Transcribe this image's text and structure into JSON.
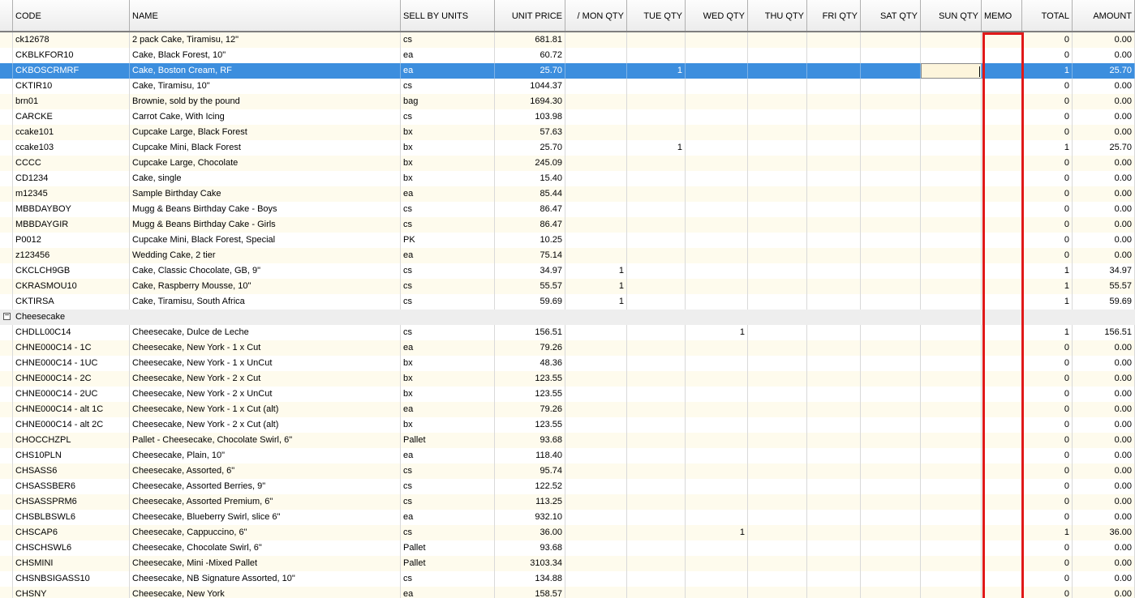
{
  "grid": {
    "columns": [
      {
        "key": "code",
        "label": "CODE",
        "align": "left"
      },
      {
        "key": "name",
        "label": "NAME",
        "align": "left"
      },
      {
        "key": "units",
        "label": "SELL BY UNITS",
        "align": "left"
      },
      {
        "key": "price",
        "label": "UNIT PRICE",
        "align": "right"
      },
      {
        "key": "mon",
        "label": "/  MON QTY",
        "align": "right"
      },
      {
        "key": "tue",
        "label": "TUE QTY",
        "align": "right"
      },
      {
        "key": "wed",
        "label": "WED QTY",
        "align": "right"
      },
      {
        "key": "thu",
        "label": "THU QTY",
        "align": "right"
      },
      {
        "key": "fri",
        "label": "FRI QTY",
        "align": "right"
      },
      {
        "key": "sat",
        "label": "SAT QTY",
        "align": "right"
      },
      {
        "key": "sun",
        "label": "SUN QTY",
        "align": "right"
      },
      {
        "key": "memo",
        "label": "MEMO",
        "align": "left"
      },
      {
        "key": "total",
        "label": "TOTAL",
        "align": "right"
      },
      {
        "key": "amount",
        "label": "AMOUNT",
        "align": "right"
      }
    ],
    "rows": [
      {
        "code": "ck12678",
        "name": "2 pack Cake, Tiramisu, 12\"",
        "units": "cs",
        "price": "681.81",
        "mon": "",
        "tue": "",
        "wed": "",
        "thu": "",
        "fri": "",
        "sat": "",
        "sun": "",
        "memo": "",
        "total": "0",
        "amount": "0.00"
      },
      {
        "code": "CKBLKFOR10",
        "name": "Cake, Black Forest, 10\"",
        "units": "ea",
        "price": "60.72",
        "mon": "",
        "tue": "",
        "wed": "",
        "thu": "",
        "fri": "",
        "sat": "",
        "sun": "",
        "memo": "",
        "total": "0",
        "amount": "0.00"
      },
      {
        "code": "CKBOSCRMRF",
        "name": "Cake, Boston Cream, RF",
        "units": "ea",
        "price": "25.70",
        "mon": "",
        "tue": "1",
        "wed": "",
        "thu": "",
        "fri": "",
        "sat": "",
        "sun": "",
        "memo": "",
        "total": "1",
        "amount": "25.70",
        "selected": true
      },
      {
        "code": "CKTIR10",
        "name": "Cake, Tiramisu, 10\"",
        "units": "cs",
        "price": "1044.37",
        "mon": "",
        "tue": "",
        "wed": "",
        "thu": "",
        "fri": "",
        "sat": "",
        "sun": "",
        "memo": "",
        "total": "0",
        "amount": "0.00"
      },
      {
        "code": "brn01",
        "name": "Brownie, sold by the pound",
        "units": "bag",
        "price": "1694.30",
        "mon": "",
        "tue": "",
        "wed": "",
        "thu": "",
        "fri": "",
        "sat": "",
        "sun": "",
        "memo": "",
        "total": "0",
        "amount": "0.00"
      },
      {
        "code": "CARCKE",
        "name": "Carrot Cake, With Icing",
        "units": "cs",
        "price": "103.98",
        "mon": "",
        "tue": "",
        "wed": "",
        "thu": "",
        "fri": "",
        "sat": "",
        "sun": "",
        "memo": "",
        "total": "0",
        "amount": "0.00"
      },
      {
        "code": "ccake101",
        "name": "Cupcake Large, Black Forest",
        "units": "bx",
        "price": "57.63",
        "mon": "",
        "tue": "",
        "wed": "",
        "thu": "",
        "fri": "",
        "sat": "",
        "sun": "",
        "memo": "",
        "total": "0",
        "amount": "0.00"
      },
      {
        "code": "ccake103",
        "name": "Cupcake Mini, Black Forest",
        "units": "bx",
        "price": "25.70",
        "mon": "",
        "tue": "1",
        "wed": "",
        "thu": "",
        "fri": "",
        "sat": "",
        "sun": "",
        "memo": "",
        "total": "1",
        "amount": "25.70"
      },
      {
        "code": "CCCC",
        "name": "Cupcake Large, Chocolate",
        "units": "bx",
        "price": "245.09",
        "mon": "",
        "tue": "",
        "wed": "",
        "thu": "",
        "fri": "",
        "sat": "",
        "sun": "",
        "memo": "",
        "total": "0",
        "amount": "0.00"
      },
      {
        "code": "CD1234",
        "name": "Cake, single",
        "units": "bx",
        "price": "15.40",
        "mon": "",
        "tue": "",
        "wed": "",
        "thu": "",
        "fri": "",
        "sat": "",
        "sun": "",
        "memo": "",
        "total": "0",
        "amount": "0.00"
      },
      {
        "code": "m12345",
        "name": "Sample Birthday Cake",
        "units": "ea",
        "price": "85.44",
        "mon": "",
        "tue": "",
        "wed": "",
        "thu": "",
        "fri": "",
        "sat": "",
        "sun": "",
        "memo": "",
        "total": "0",
        "amount": "0.00"
      },
      {
        "code": "MBBDAYBOY",
        "name": "Mugg & Beans Birthday Cake - Boys",
        "units": "cs",
        "price": "86.47",
        "mon": "",
        "tue": "",
        "wed": "",
        "thu": "",
        "fri": "",
        "sat": "",
        "sun": "",
        "memo": "",
        "total": "0",
        "amount": "0.00"
      },
      {
        "code": "MBBDAYGIR",
        "name": "Mugg & Beans Birthday Cake - Girls",
        "units": "cs",
        "price": "86.47",
        "mon": "",
        "tue": "",
        "wed": "",
        "thu": "",
        "fri": "",
        "sat": "",
        "sun": "",
        "memo": "",
        "total": "0",
        "amount": "0.00"
      },
      {
        "code": "P0012",
        "name": "Cupcake Mini, Black Forest, Special",
        "units": "PK",
        "price": "10.25",
        "mon": "",
        "tue": "",
        "wed": "",
        "thu": "",
        "fri": "",
        "sat": "",
        "sun": "",
        "memo": "",
        "total": "0",
        "amount": "0.00"
      },
      {
        "code": "z123456",
        "name": "Wedding Cake, 2 tier",
        "units": "ea",
        "price": "75.14",
        "mon": "",
        "tue": "",
        "wed": "",
        "thu": "",
        "fri": "",
        "sat": "",
        "sun": "",
        "memo": "",
        "total": "0",
        "amount": "0.00"
      },
      {
        "code": "CKCLCH9GB",
        "name": "Cake, Classic Chocolate, GB, 9\"",
        "units": "cs",
        "price": "34.97",
        "mon": "1",
        "tue": "",
        "wed": "",
        "thu": "",
        "fri": "",
        "sat": "",
        "sun": "",
        "memo": "",
        "total": "1",
        "amount": "34.97"
      },
      {
        "code": "CKRASMOU10",
        "name": "Cake, Raspberry Mousse, 10\"",
        "units": "cs",
        "price": "55.57",
        "mon": "1",
        "tue": "",
        "wed": "",
        "thu": "",
        "fri": "",
        "sat": "",
        "sun": "",
        "memo": "",
        "total": "1",
        "amount": "55.57"
      },
      {
        "code": "CKTIRSA",
        "name": "Cake, Tiramisu, South Africa",
        "units": "cs",
        "price": "59.69",
        "mon": "1",
        "tue": "",
        "wed": "",
        "thu": "",
        "fri": "",
        "sat": "",
        "sun": "",
        "memo": "",
        "total": "1",
        "amount": "59.69"
      },
      {
        "group": "Cheesecake",
        "toggle": "−"
      },
      {
        "code": "CHDLL00C14",
        "name": "Cheesecake, Dulce de Leche",
        "units": "cs",
        "price": "156.51",
        "mon": "",
        "tue": "",
        "wed": "1",
        "thu": "",
        "fri": "",
        "sat": "",
        "sun": "",
        "memo": "",
        "total": "1",
        "amount": "156.51"
      },
      {
        "code": "CHNE000C14 - 1C",
        "name": "Cheesecake, New York - 1 x Cut",
        "units": "ea",
        "price": "79.26",
        "mon": "",
        "tue": "",
        "wed": "",
        "thu": "",
        "fri": "",
        "sat": "",
        "sun": "",
        "memo": "",
        "total": "0",
        "amount": "0.00"
      },
      {
        "code": "CHNE000C14 - 1UC",
        "name": "Cheesecake, New York - 1 x UnCut",
        "units": "bx",
        "price": "48.36",
        "mon": "",
        "tue": "",
        "wed": "",
        "thu": "",
        "fri": "",
        "sat": "",
        "sun": "",
        "memo": "",
        "total": "0",
        "amount": "0.00"
      },
      {
        "code": "CHNE000C14 - 2C",
        "name": "Cheesecake, New York - 2 x Cut",
        "units": "bx",
        "price": "123.55",
        "mon": "",
        "tue": "",
        "wed": "",
        "thu": "",
        "fri": "",
        "sat": "",
        "sun": "",
        "memo": "",
        "total": "0",
        "amount": "0.00"
      },
      {
        "code": "CHNE000C14 - 2UC",
        "name": "Cheesecake, New York - 2 x UnCut",
        "units": "bx",
        "price": "123.55",
        "mon": "",
        "tue": "",
        "wed": "",
        "thu": "",
        "fri": "",
        "sat": "",
        "sun": "",
        "memo": "",
        "total": "0",
        "amount": "0.00"
      },
      {
        "code": "CHNE000C14 - alt 1C",
        "name": "Cheesecake, New York - 1 x Cut (alt)",
        "units": "ea",
        "price": "79.26",
        "mon": "",
        "tue": "",
        "wed": "",
        "thu": "",
        "fri": "",
        "sat": "",
        "sun": "",
        "memo": "",
        "total": "0",
        "amount": "0.00"
      },
      {
        "code": "CHNE000C14 - alt 2C",
        "name": "Cheesecake, New York - 2 x Cut (alt)",
        "units": "bx",
        "price": "123.55",
        "mon": "",
        "tue": "",
        "wed": "",
        "thu": "",
        "fri": "",
        "sat": "",
        "sun": "",
        "memo": "",
        "total": "0",
        "amount": "0.00"
      },
      {
        "code": "CHOCCHZPL",
        "name": "Pallet - Cheesecake, Chocolate Swirl, 6\"",
        "units": "Pallet",
        "price": "93.68",
        "mon": "",
        "tue": "",
        "wed": "",
        "thu": "",
        "fri": "",
        "sat": "",
        "sun": "",
        "memo": "",
        "total": "0",
        "amount": "0.00"
      },
      {
        "code": "CHS10PLN",
        "name": "Cheesecake, Plain, 10\"",
        "units": "ea",
        "price": "118.40",
        "mon": "",
        "tue": "",
        "wed": "",
        "thu": "",
        "fri": "",
        "sat": "",
        "sun": "",
        "memo": "",
        "total": "0",
        "amount": "0.00"
      },
      {
        "code": "CHSASS6",
        "name": "Cheesecake, Assorted, 6\"",
        "units": "cs",
        "price": "95.74",
        "mon": "",
        "tue": "",
        "wed": "",
        "thu": "",
        "fri": "",
        "sat": "",
        "sun": "",
        "memo": "",
        "total": "0",
        "amount": "0.00"
      },
      {
        "code": "CHSASSBER6",
        "name": "Cheesecake, Assorted Berries, 9\"",
        "units": "cs",
        "price": "122.52",
        "mon": "",
        "tue": "",
        "wed": "",
        "thu": "",
        "fri": "",
        "sat": "",
        "sun": "",
        "memo": "",
        "total": "0",
        "amount": "0.00"
      },
      {
        "code": "CHSASSPRM6",
        "name": "Cheesecake, Assorted Premium, 6\"",
        "units": "cs",
        "price": "113.25",
        "mon": "",
        "tue": "",
        "wed": "",
        "thu": "",
        "fri": "",
        "sat": "",
        "sun": "",
        "memo": "",
        "total": "0",
        "amount": "0.00"
      },
      {
        "code": "CHSBLBSWL6",
        "name": "Cheesecake, Blueberry Swirl, slice  6\"",
        "units": "ea",
        "price": "932.10",
        "mon": "",
        "tue": "",
        "wed": "",
        "thu": "",
        "fri": "",
        "sat": "",
        "sun": "",
        "memo": "",
        "total": "0",
        "amount": "0.00"
      },
      {
        "code": "CHSCAP6",
        "name": "Cheesecake, Cappuccino, 6\"",
        "units": "cs",
        "price": "36.00",
        "mon": "",
        "tue": "",
        "wed": "1",
        "thu": "",
        "fri": "",
        "sat": "",
        "sun": "",
        "memo": "",
        "total": "1",
        "amount": "36.00"
      },
      {
        "code": "CHSCHSWL6",
        "name": "Cheesecake, Chocolate Swirl, 6\"",
        "units": "Pallet",
        "price": "93.68",
        "mon": "",
        "tue": "",
        "wed": "",
        "thu": "",
        "fri": "",
        "sat": "",
        "sun": "",
        "memo": "",
        "total": "0",
        "amount": "0.00"
      },
      {
        "code": "CHSMINI",
        "name": "Cheesecake, Mini -Mixed Pallet",
        "units": "Pallet",
        "price": "3103.34",
        "mon": "",
        "tue": "",
        "wed": "",
        "thu": "",
        "fri": "",
        "sat": "",
        "sun": "",
        "memo": "",
        "total": "0",
        "amount": "0.00"
      },
      {
        "code": "CHSNBSIGASS10",
        "name": "Cheesecake, NB Signature Assorted, 10\"",
        "units": "cs",
        "price": "134.88",
        "mon": "",
        "tue": "",
        "wed": "",
        "thu": "",
        "fri": "",
        "sat": "",
        "sun": "",
        "memo": "",
        "total": "0",
        "amount": "0.00"
      },
      {
        "code": "CHSNY",
        "name": "Cheesecake, New York",
        "units": "ea",
        "price": "158.57",
        "mon": "",
        "tue": "",
        "wed": "",
        "thu": "",
        "fri": "",
        "sat": "",
        "sun": "",
        "memo": "",
        "total": "0",
        "amount": "0.00"
      }
    ]
  },
  "highlight": {
    "column": "MEMO",
    "color": "#e01919"
  },
  "colors": {
    "selected_row": "#3c8ede",
    "alt_row": "#fefbed",
    "group_row": "#eeeeee"
  }
}
